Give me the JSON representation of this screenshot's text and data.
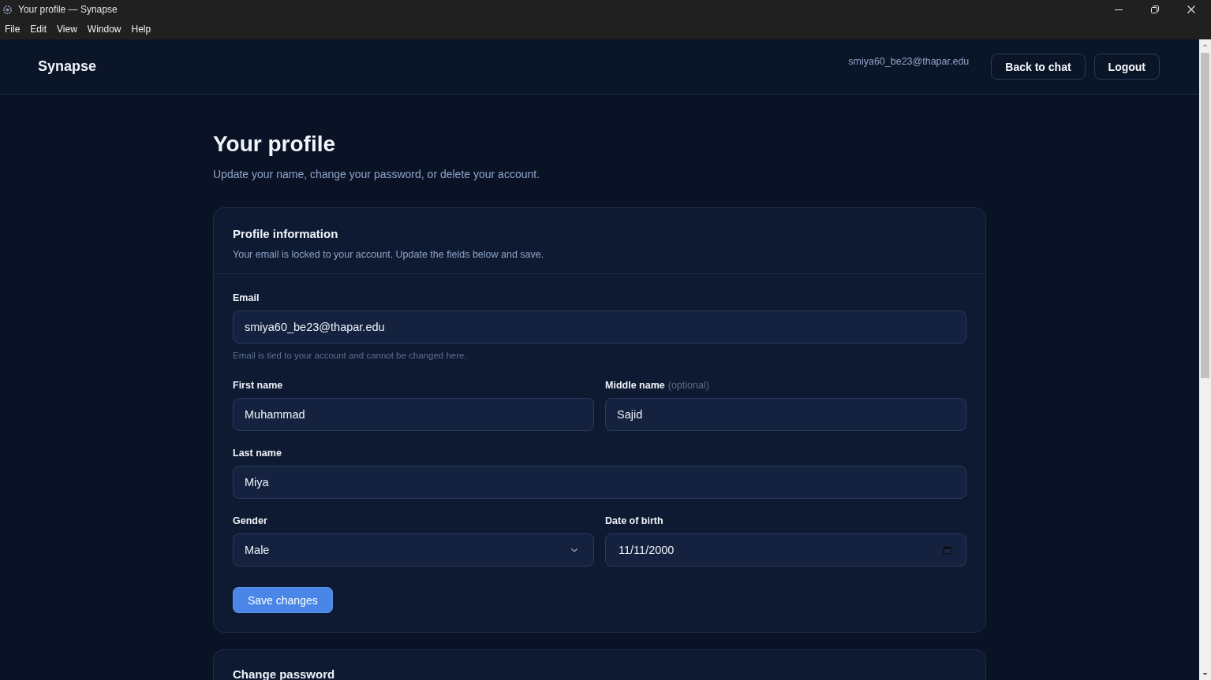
{
  "window": {
    "title": "Your profile — Synapse"
  },
  "menu_bar": [
    "File",
    "Edit",
    "View",
    "Window",
    "Help"
  ],
  "header": {
    "brand": "Synapse",
    "user_email": "smiya60_be23@thapar.edu",
    "buttons": [
      "Back to chat",
      "Logout"
    ]
  },
  "page": {
    "title": "Your profile",
    "subtitle": "Update your name, change your password, or delete your account."
  },
  "profile_card": {
    "title": "Profile information",
    "description": "Your email is locked to your account. Update the fields below and save.",
    "rows": [
      {
        "fields": [
          {
            "kind": "text",
            "label": "Email",
            "value": "smiya60_be23@thapar.edu",
            "help": "Email is tied to your account and cannot be changed here."
          }
        ]
      },
      {
        "fields": [
          {
            "kind": "text",
            "label": "First name",
            "value": "Muhammad"
          },
          {
            "kind": "text",
            "label": "Middle name",
            "note": "(optional)",
            "value": "Sajid"
          }
        ]
      },
      {
        "fields": [
          {
            "kind": "text",
            "label": "Last name",
            "value": "Miya"
          }
        ]
      },
      {
        "fields": [
          {
            "kind": "select",
            "label": "Gender",
            "value": "Male"
          },
          {
            "kind": "date",
            "label": "Date of birth",
            "value": "11/11/2000"
          }
        ]
      }
    ],
    "save_button": "Save changes"
  },
  "password_card": {
    "title": "Change password"
  }
}
